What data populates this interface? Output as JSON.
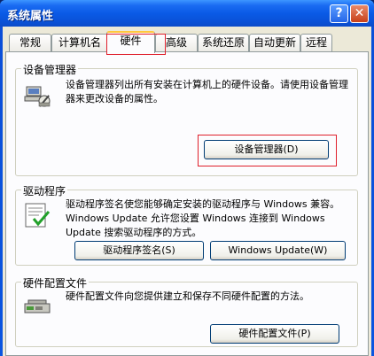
{
  "window": {
    "title": "系统属性",
    "help_label": "?",
    "close_label": "✕"
  },
  "tabs": [
    {
      "label": "常规",
      "active": false
    },
    {
      "label": "计算机名",
      "active": false
    },
    {
      "label": "硬件",
      "active": true
    },
    {
      "label": "高级",
      "active": false
    },
    {
      "label": "系统还原",
      "active": false
    },
    {
      "label": "自动更新",
      "active": false
    },
    {
      "label": "远程",
      "active": false
    }
  ],
  "device_manager": {
    "title": "设备管理器",
    "description": "设备管理器列出所有安装在计算机上的硬件设备。请使用设备管理器来更改设备的属性。",
    "button_label": "设备管理器(D)",
    "icon": "device-manager-icon"
  },
  "drivers": {
    "title": "驱动程序",
    "description": "驱动程序签名使您能够确定安装的驱动程序与 Windows 兼容。Windows Update 允许您设置 Windows 连接到 Windows Update 搜索驱动程序的方式。",
    "signing_button_label": "驱动程序签名(S)",
    "update_button_label": "Windows Update(W)",
    "icon": "driver-signing-icon"
  },
  "hardware_profiles": {
    "title": "硬件配置文件",
    "description": "硬件配置文件向您提供建立和保存不同硬件配置的方法。",
    "button_label": "硬件配置文件(P)",
    "icon": "hardware-profile-icon"
  },
  "colors": {
    "title_bar": "#0a5ae6",
    "dialog_bg": "#ece9d8",
    "highlight": "#e0202c",
    "tab_active_accent": "#ffc83c"
  }
}
